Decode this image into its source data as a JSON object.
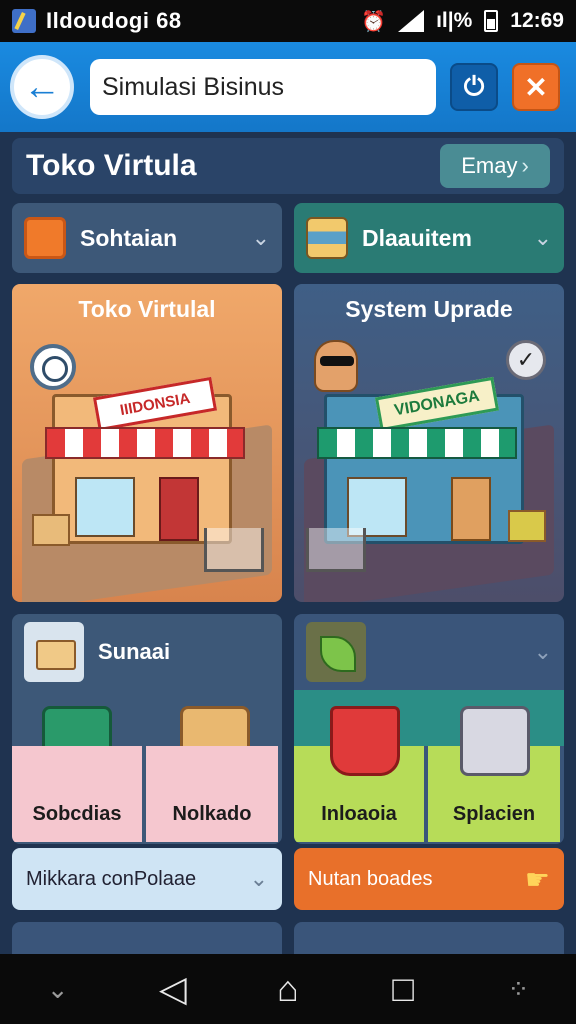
{
  "status_bar": {
    "app_name": "Ildoudogi 68",
    "signal_text": "ıl|%",
    "time": "12:69"
  },
  "app_bar": {
    "search_value": "Simulasi Bisinus"
  },
  "header": {
    "title": "Toko Virtula",
    "play_label": "Emay"
  },
  "dropdowns": {
    "left": {
      "label": "Sohtaian",
      "icon": "box-icon"
    },
    "right": {
      "label": "Dlaauitem",
      "icon": "stack-icon"
    }
  },
  "cards": {
    "left": {
      "title": "Toko Virtulal",
      "sign": "IIIDONSIA"
    },
    "right": {
      "title": "System Uprade",
      "sign": "VIDONAGA"
    }
  },
  "panels": {
    "left": {
      "label": "Sunaai",
      "tiles": [
        "Sobcdias",
        "Nolkado"
      ],
      "bar": "Mikkara conPolaae"
    },
    "right": {
      "label": "",
      "tiles": [
        "Inloaoia",
        "Splacien"
      ],
      "bar": "Nutan boades"
    }
  },
  "colors": {
    "appbar": "#1a8ae0",
    "accent_orange": "#f07028",
    "teal": "#2a7b74"
  }
}
